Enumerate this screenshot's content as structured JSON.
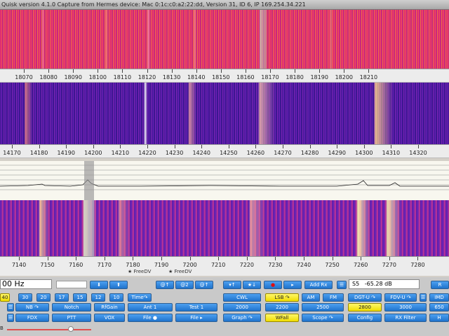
{
  "title": "Quisk version 4.1.0    Capture from Hermes device: Mac  0:1c:c0:a2:22:dd, Version 31, ID 6, IP 169.254.34.221",
  "scales": [
    {
      "name": "band-18",
      "labels": [
        "18070",
        "18080",
        "18090",
        "18100",
        "18110",
        "18120",
        "18130",
        "18140",
        "18150",
        "18160",
        "18170",
        "18180",
        "18190",
        "18200",
        "18210"
      ]
    },
    {
      "name": "band-14",
      "labels": [
        "14170",
        "14180",
        "14190",
        "14200",
        "14210",
        "14220",
        "14230",
        "14240",
        "14250",
        "14260",
        "14270",
        "14280",
        "14290",
        "14300",
        "14310",
        "14320"
      ]
    },
    {
      "name": "band-7",
      "labels": [
        "7140",
        "7150",
        "7160",
        "7170",
        "7180",
        "7190",
        "7200",
        "7210",
        "7220",
        "7230",
        "7240",
        "7250",
        "7260",
        "7270",
        "7280"
      ]
    }
  ],
  "fdv_labels": [
    "★ FreeDV",
    "★ FreeDV"
  ],
  "freq_display": "00 Hz",
  "smeter": {
    "value": "S5   -65.28 dB"
  },
  "slider_label": "B",
  "buttons": {
    "row1": [
      "⬇",
      "⬆",
      "@↑",
      "@2",
      "@↑",
      "▾↑",
      "★↓",
      "●",
      "▸",
      "Add Rx",
      "R"
    ],
    "row2": [
      "40",
      "30",
      "20",
      "17",
      "15",
      "12",
      "10",
      "Time↷",
      "CWL",
      "LSB ↷",
      "AM",
      "FM",
      "DGT-U ↷",
      "FDV-U ↷",
      "IMD"
    ],
    "row3": [
      "NB ↷",
      "Notch",
      "RfGain",
      "Ant 1",
      "Test 1",
      "2000",
      "2200",
      "2500",
      "2800",
      "3000",
      "650"
    ],
    "row4": [
      "FDX",
      "PTT",
      "VOX",
      "File ●",
      "File ▸",
      "Graph ↷",
      "WFall",
      "Scope ↷",
      "Config",
      "RX Filter",
      "H"
    ]
  }
}
